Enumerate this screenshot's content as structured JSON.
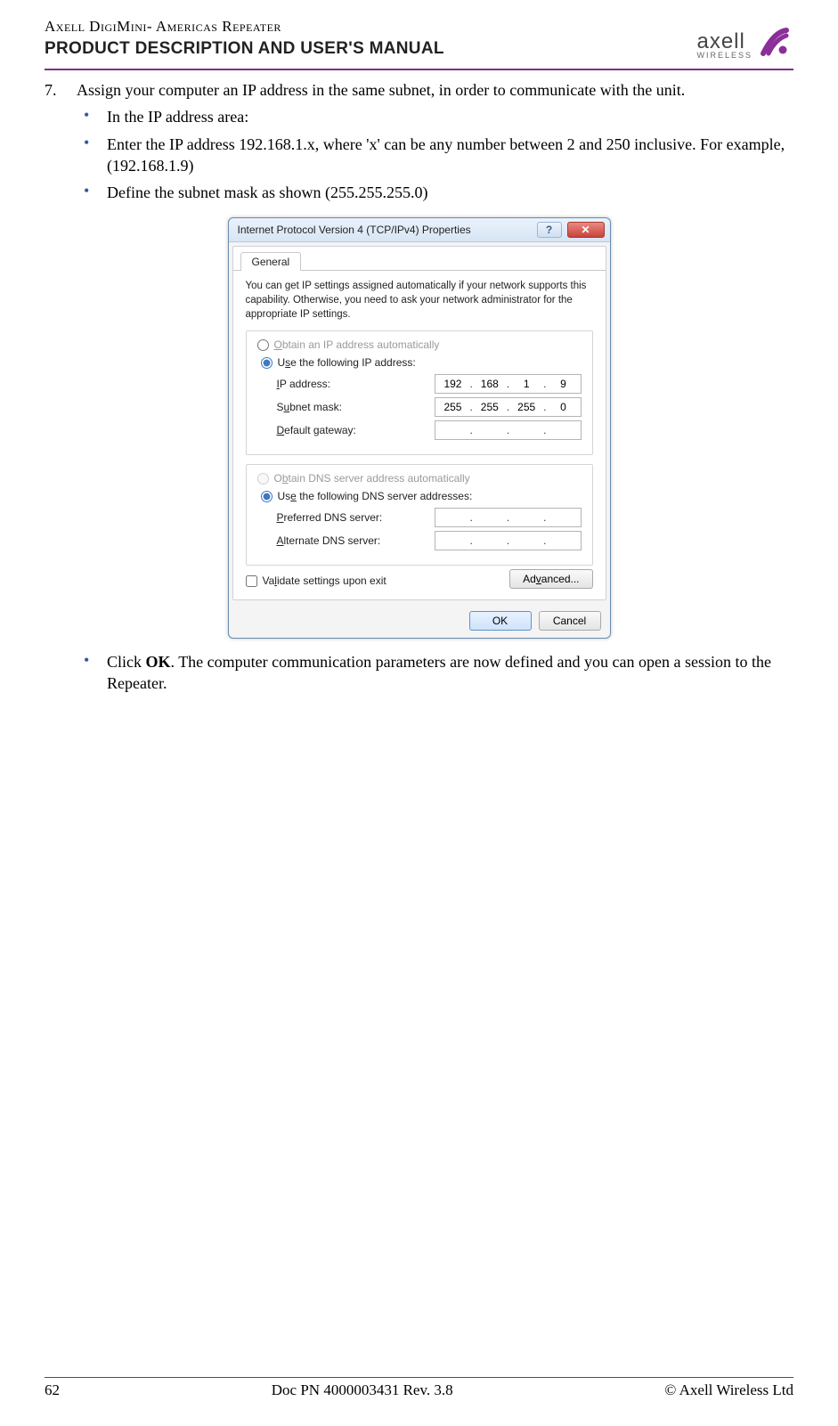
{
  "header": {
    "product_line": "Axell DigiMini- Americas Repeater",
    "manual_title": "PRODUCT DESCRIPTION AND USER'S MANUAL",
    "logo_text": "axell",
    "logo_sub": "WIRELESS"
  },
  "step": {
    "number": "7.",
    "text": "Assign your computer an IP address in the same subnet, in order to communicate with the unit."
  },
  "bullets_top": [
    "In the IP address area:",
    "Enter the IP address 192.168.1.x, where 'x' can be any number between 2 and 250 inclusive. For example,  (192.168.1.9)",
    "Define the subnet mask as shown (255.255.255.0)"
  ],
  "dialog": {
    "title": "Internet Protocol Version 4 (TCP/IPv4) Properties",
    "tab": "General",
    "description": "You can get IP settings assigned automatically if your network supports this capability. Otherwise, you need to ask your network administrator for the appropriate IP settings.",
    "radio_auto_ip": "Obtain an IP address automatically",
    "radio_use_ip": "Use the following IP address:",
    "label_ip": "IP address:",
    "label_mask": "Subnet mask:",
    "label_gw": "Default gateway:",
    "ip": [
      "192",
      "168",
      "1",
      "9"
    ],
    "mask": [
      "255",
      "255",
      "255",
      "0"
    ],
    "gw": [
      "",
      "",
      "",
      ""
    ],
    "radio_auto_dns": "Obtain DNS server address automatically",
    "radio_use_dns": "Use the following DNS server addresses:",
    "label_pref_dns": "Preferred DNS server:",
    "label_alt_dns": "Alternate DNS server:",
    "pref_dns": [
      "",
      "",
      "",
      ""
    ],
    "alt_dns": [
      "",
      "",
      "",
      ""
    ],
    "validate": "Validate settings upon exit",
    "advanced": "Advanced...",
    "ok": "OK",
    "cancel": "Cancel"
  },
  "bullets_bottom": {
    "pre": "Click ",
    "bold": "OK",
    "post": ". The computer communication parameters are now defined and you can open a session to the Repeater."
  },
  "footer": {
    "page": "62",
    "doc": "Doc PN 4000003431 Rev. 3.8",
    "copyright": "© Axell Wireless Ltd"
  }
}
